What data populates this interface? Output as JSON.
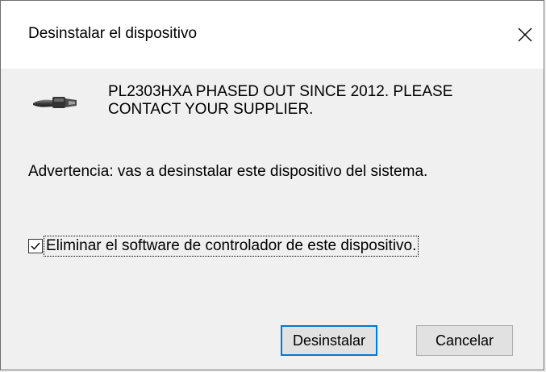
{
  "window": {
    "title": "Desinstalar el dispositivo",
    "close_icon": "close-icon"
  },
  "device": {
    "icon": "usb-serial-cable-icon",
    "name": "PL2303HXA PHASED OUT SINCE 2012. PLEASE CONTACT YOUR SUPPLIER."
  },
  "warning_text": "Advertencia: vas a desinstalar este dispositivo del sistema.",
  "option": {
    "label": "Eliminar el software de controlador de este dispositivo.",
    "checked": true
  },
  "buttons": {
    "uninstall_label": "Desinstalar",
    "cancel_label": "Cancelar"
  },
  "colors": {
    "accent": "#0078d7",
    "title_background": "#ffffff",
    "dialog_background": "#f0f0f0",
    "button_background": "#e1e1e1"
  }
}
